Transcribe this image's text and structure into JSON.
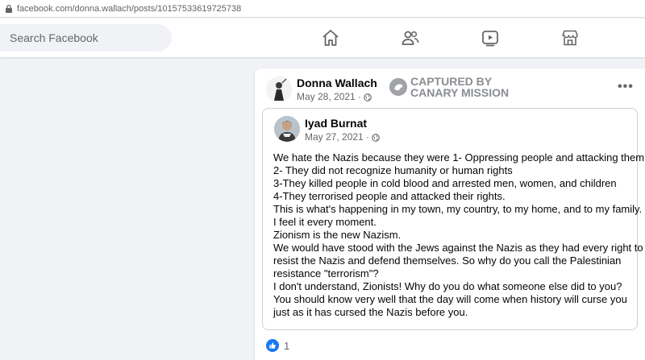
{
  "browser": {
    "url": "facebook.com/donna.wallach/posts/10157533619725738"
  },
  "topnav": {
    "search_placeholder": "Search Facebook",
    "icons": [
      "home-icon",
      "friends-icon",
      "watch-icon",
      "marketplace-icon"
    ]
  },
  "post": {
    "author": "Donna Wallach",
    "date": "May 28, 2021 ·",
    "watermark": {
      "line1": "CAPTURED BY",
      "line2": "CANARY MISSION"
    },
    "more_label": "•••",
    "shared_post": {
      "author": "Iyad Burnat",
      "date": "May 27, 2021 ·",
      "lines": [
        "We hate the Nazis because they were 1- Oppressing people and attacking them",
        "2- They did not recognize humanity or human rights",
        "3-They killed people in cold blood and arrested men, women, and children",
        "4-They terrorised people and attacked their rights.",
        "This is what's happening in my town, my country, to my home, and to my family.",
        "I feel it every moment.",
        "Zionism is the new Nazism.",
        "We would have stood with the Jews against the Nazis as they had every right to",
        "resist the Nazis and defend themselves. So why do you call the Palestinian",
        "resistance \"terrorism\"?",
        "I don't understand, Zionists! Why do you do what someone else did to you?",
        "You should know very well that the day will come when history will curse you",
        "just as it has cursed the Nazis before you."
      ]
    },
    "reaction_count": "1"
  },
  "colors": {
    "accent": "#1877f2",
    "background": "#f0f2f5",
    "secondary_text": "#65676b",
    "watermark": "#8a8d91"
  }
}
